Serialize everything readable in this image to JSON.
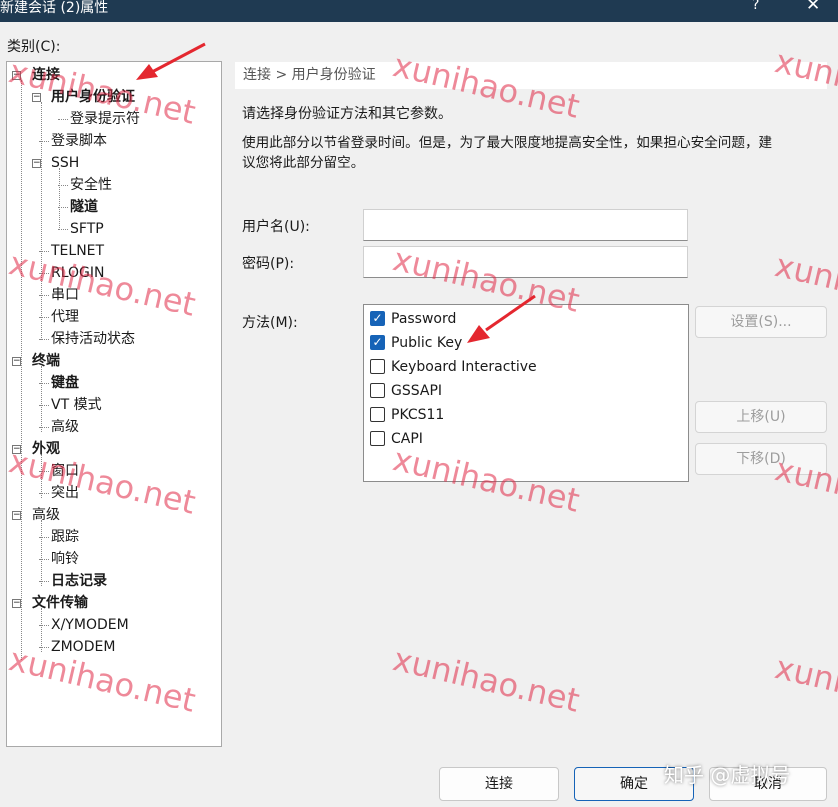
{
  "window": {
    "title": "新建会话 (2)属性",
    "help": "?",
    "close": "✕"
  },
  "category_label": "类别(C):",
  "tree": [
    {
      "label": "连接",
      "bold": true,
      "toggle": "minus"
    },
    {
      "label": "用户身份验证",
      "bold": true,
      "toggle": "minus"
    },
    {
      "label": "登录提示符"
    },
    {
      "label": "登录脚本"
    },
    {
      "label": "SSH",
      "toggle": "minus"
    },
    {
      "label": "安全性"
    },
    {
      "label": "隧道",
      "bold": true
    },
    {
      "label": "SFTP"
    },
    {
      "label": "TELNET"
    },
    {
      "label": "RLOGIN"
    },
    {
      "label": "串口"
    },
    {
      "label": "代理"
    },
    {
      "label": "保持活动状态"
    },
    {
      "label": "终端",
      "bold": true,
      "toggle": "minus"
    },
    {
      "label": "键盘",
      "bold": true
    },
    {
      "label": "VT 模式"
    },
    {
      "label": "高级"
    },
    {
      "label": "外观",
      "bold": true,
      "toggle": "minus"
    },
    {
      "label": "窗口"
    },
    {
      "label": "突出"
    },
    {
      "label": "高级",
      "toggle": "minus"
    },
    {
      "label": "跟踪"
    },
    {
      "label": "响铃"
    },
    {
      "label": "日志记录",
      "bold": true
    },
    {
      "label": "文件传输",
      "bold": true,
      "toggle": "minus"
    },
    {
      "label": "X/YMODEM"
    },
    {
      "label": "ZMODEM"
    }
  ],
  "breadcrumb": "连接 > 用户身份验证",
  "desc1": "请选择身份验证方法和其它参数。",
  "desc2a": "使用此部分以节省登录时间。但是，为了最大限度地提高安全性，如果担心安全问题，建",
  "desc2b": "议您将此部分留空。",
  "username_label": "用户名(U):",
  "username_value": "",
  "password_label": "密码(P):",
  "password_value": "",
  "method_label": "方法(M):",
  "methods": [
    {
      "label": "Password",
      "checked": true
    },
    {
      "label": "Public Key",
      "checked": true
    },
    {
      "label": "Keyboard Interactive",
      "checked": false
    },
    {
      "label": "GSSAPI",
      "checked": false
    },
    {
      "label": "PKCS11",
      "checked": false
    },
    {
      "label": "CAPI",
      "checked": false
    }
  ],
  "buttons": {
    "settings": "设置(S)...",
    "move_up": "上移(U)",
    "move_down": "下移(D)",
    "connect": "连接",
    "ok": "确定",
    "cancel": "取消"
  },
  "watermark": "xunihao.net",
  "footer_watermark": "知乎 @虚拟号",
  "colors": {
    "titlebar": "#1f3a52",
    "accent": "#1663b7",
    "annotation_arrow": "#e4272f"
  }
}
